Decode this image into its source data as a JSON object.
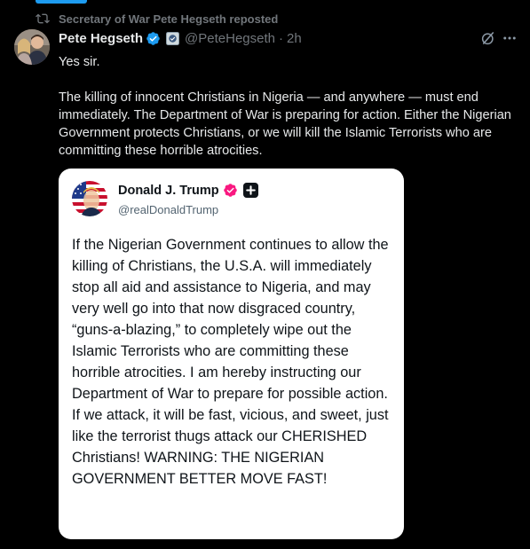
{
  "repost": {
    "label": "Secretary of War Pete Hegseth reposted",
    "icon": "repost-icon"
  },
  "post": {
    "author_name": "Pete Hegseth",
    "handle": "@PeteHegseth",
    "separator": "·",
    "time": "2h",
    "paragraphs": [
      "Yes sir.",
      "The killing of innocent Christians in Nigeria — and anywhere — must end immediately. The Department of War is preparing for action. Either the Nigerian Government protects Christians, or we will kill the Islamic Terrorists who are committing these horrible atrocities."
    ]
  },
  "quote": {
    "author_name": "Donald J. Trump",
    "handle": "@realDonaldTrump",
    "text": "If the Nigerian Government continues to allow the killing of Christians, the U.S.A. will immediately stop all aid and assistance to Nigeria, and may very well go into that now disgraced country, “guns-a-blazing,” to completely wipe out the Islamic Terrorists who are committing these horrible atrocities. I am hereby instructing our Department of War to prepare for possible action. If we attack, it will be fast, vicious, and sweet, just like the terrorist thugs attack our CHERISHED Christians! WARNING: THE NIGERIAN GOVERNMENT BETTER MOVE FAST!"
  },
  "colors": {
    "background": "#000000",
    "accent": "#1d9bf0",
    "verified_blue": "#1d9bf0",
    "quote_verified": "#f91880",
    "muted_text": "#71767b"
  }
}
